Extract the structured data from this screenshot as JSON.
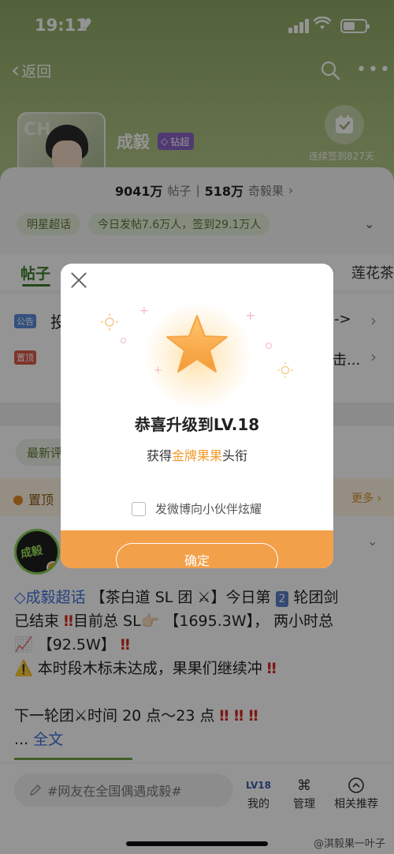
{
  "status_bar": {
    "time": "19:11",
    "heart": "♥"
  },
  "nav": {
    "back_label": "返回"
  },
  "profile": {
    "name": "成毅",
    "diamond_badge": "钻超",
    "checkin_text": "连续签到827天",
    "posts_count": "9041万",
    "posts_label": "帖子",
    "fans_count": "518万",
    "fans_label": "奇毅果",
    "tags": [
      "明星超话",
      "今日发帖7.6万人，签到29.1万人"
    ]
  },
  "tabs": {
    "active": "帖子",
    "right": "莲花茶"
  },
  "notices": {
    "badge_1": "公告",
    "line_1_start": "投",
    "line_1_end": "->",
    "badge_2": "置顶",
    "line_2_end": "击..."
  },
  "feed": {
    "filter_label": "最新评",
    "pinned_title": "置顶",
    "pinned_more": "更多",
    "post": {
      "lines": [
        {
          "parts": [
            {
              "text": "◇成毅超话",
              "cls": "blue"
            },
            {
              "text": " 【茶白道 SL 团 ⚔】今日第 ",
              "cls": ""
            },
            {
              "text": "2",
              "cls": "num2"
            },
            {
              "text": " 轮团剑",
              "cls": ""
            }
          ]
        },
        {
          "parts": [
            {
              "text": "已结束 ",
              "cls": ""
            },
            {
              "text": "‼",
              "cls": "red"
            },
            {
              "text": "目前总 SL👉🏻 【1695.3W】， 两小时总",
              "cls": ""
            }
          ]
        },
        {
          "parts": [
            {
              "text": "📈 【92.5W】 ",
              "cls": ""
            },
            {
              "text": "‼",
              "cls": "red"
            }
          ]
        },
        {
          "parts": [
            {
              "text": "⚠️ 本时段木标未达成，果果们继续冲 ",
              "cls": ""
            },
            {
              "text": "‼",
              "cls": "red"
            }
          ]
        },
        {
          "parts": [
            {
              "text": " ",
              "cls": ""
            }
          ]
        },
        {
          "parts": [
            {
              "text": "下一轮团⚔时间 20 点～23 点 ",
              "cls": ""
            },
            {
              "text": "‼ ‼ ‼",
              "cls": "red"
            }
          ]
        },
        {
          "parts": [
            {
              "text": "... ",
              "cls": ""
            },
            {
              "text": "全文",
              "cls": "blue"
            }
          ]
        }
      ]
    }
  },
  "bottom": {
    "compose_placeholder": "#网友在全国偶遇成毅#",
    "nav_items": [
      {
        "label": "我的",
        "icon": "level-icon",
        "glyph": "LV18"
      },
      {
        "label": "管理",
        "icon": "manage-icon",
        "glyph": "⌘"
      },
      {
        "label": "相关推荐",
        "icon": "recommend-icon",
        "glyph": "⌃"
      }
    ]
  },
  "watermark": "@淇毅果一叶子",
  "modal": {
    "title": "恭喜升级到LV.18",
    "subtitle_prefix": "获得",
    "subtitle_highlight": "金牌果果",
    "subtitle_suffix": "头衔",
    "share_label": "发微博向小伙伴炫耀",
    "confirm_label": "确定"
  },
  "colors": {
    "accent_green": "#3f7d2c",
    "modal_orange": "#f3a04a",
    "highlight_orange": "#f29b2b"
  }
}
